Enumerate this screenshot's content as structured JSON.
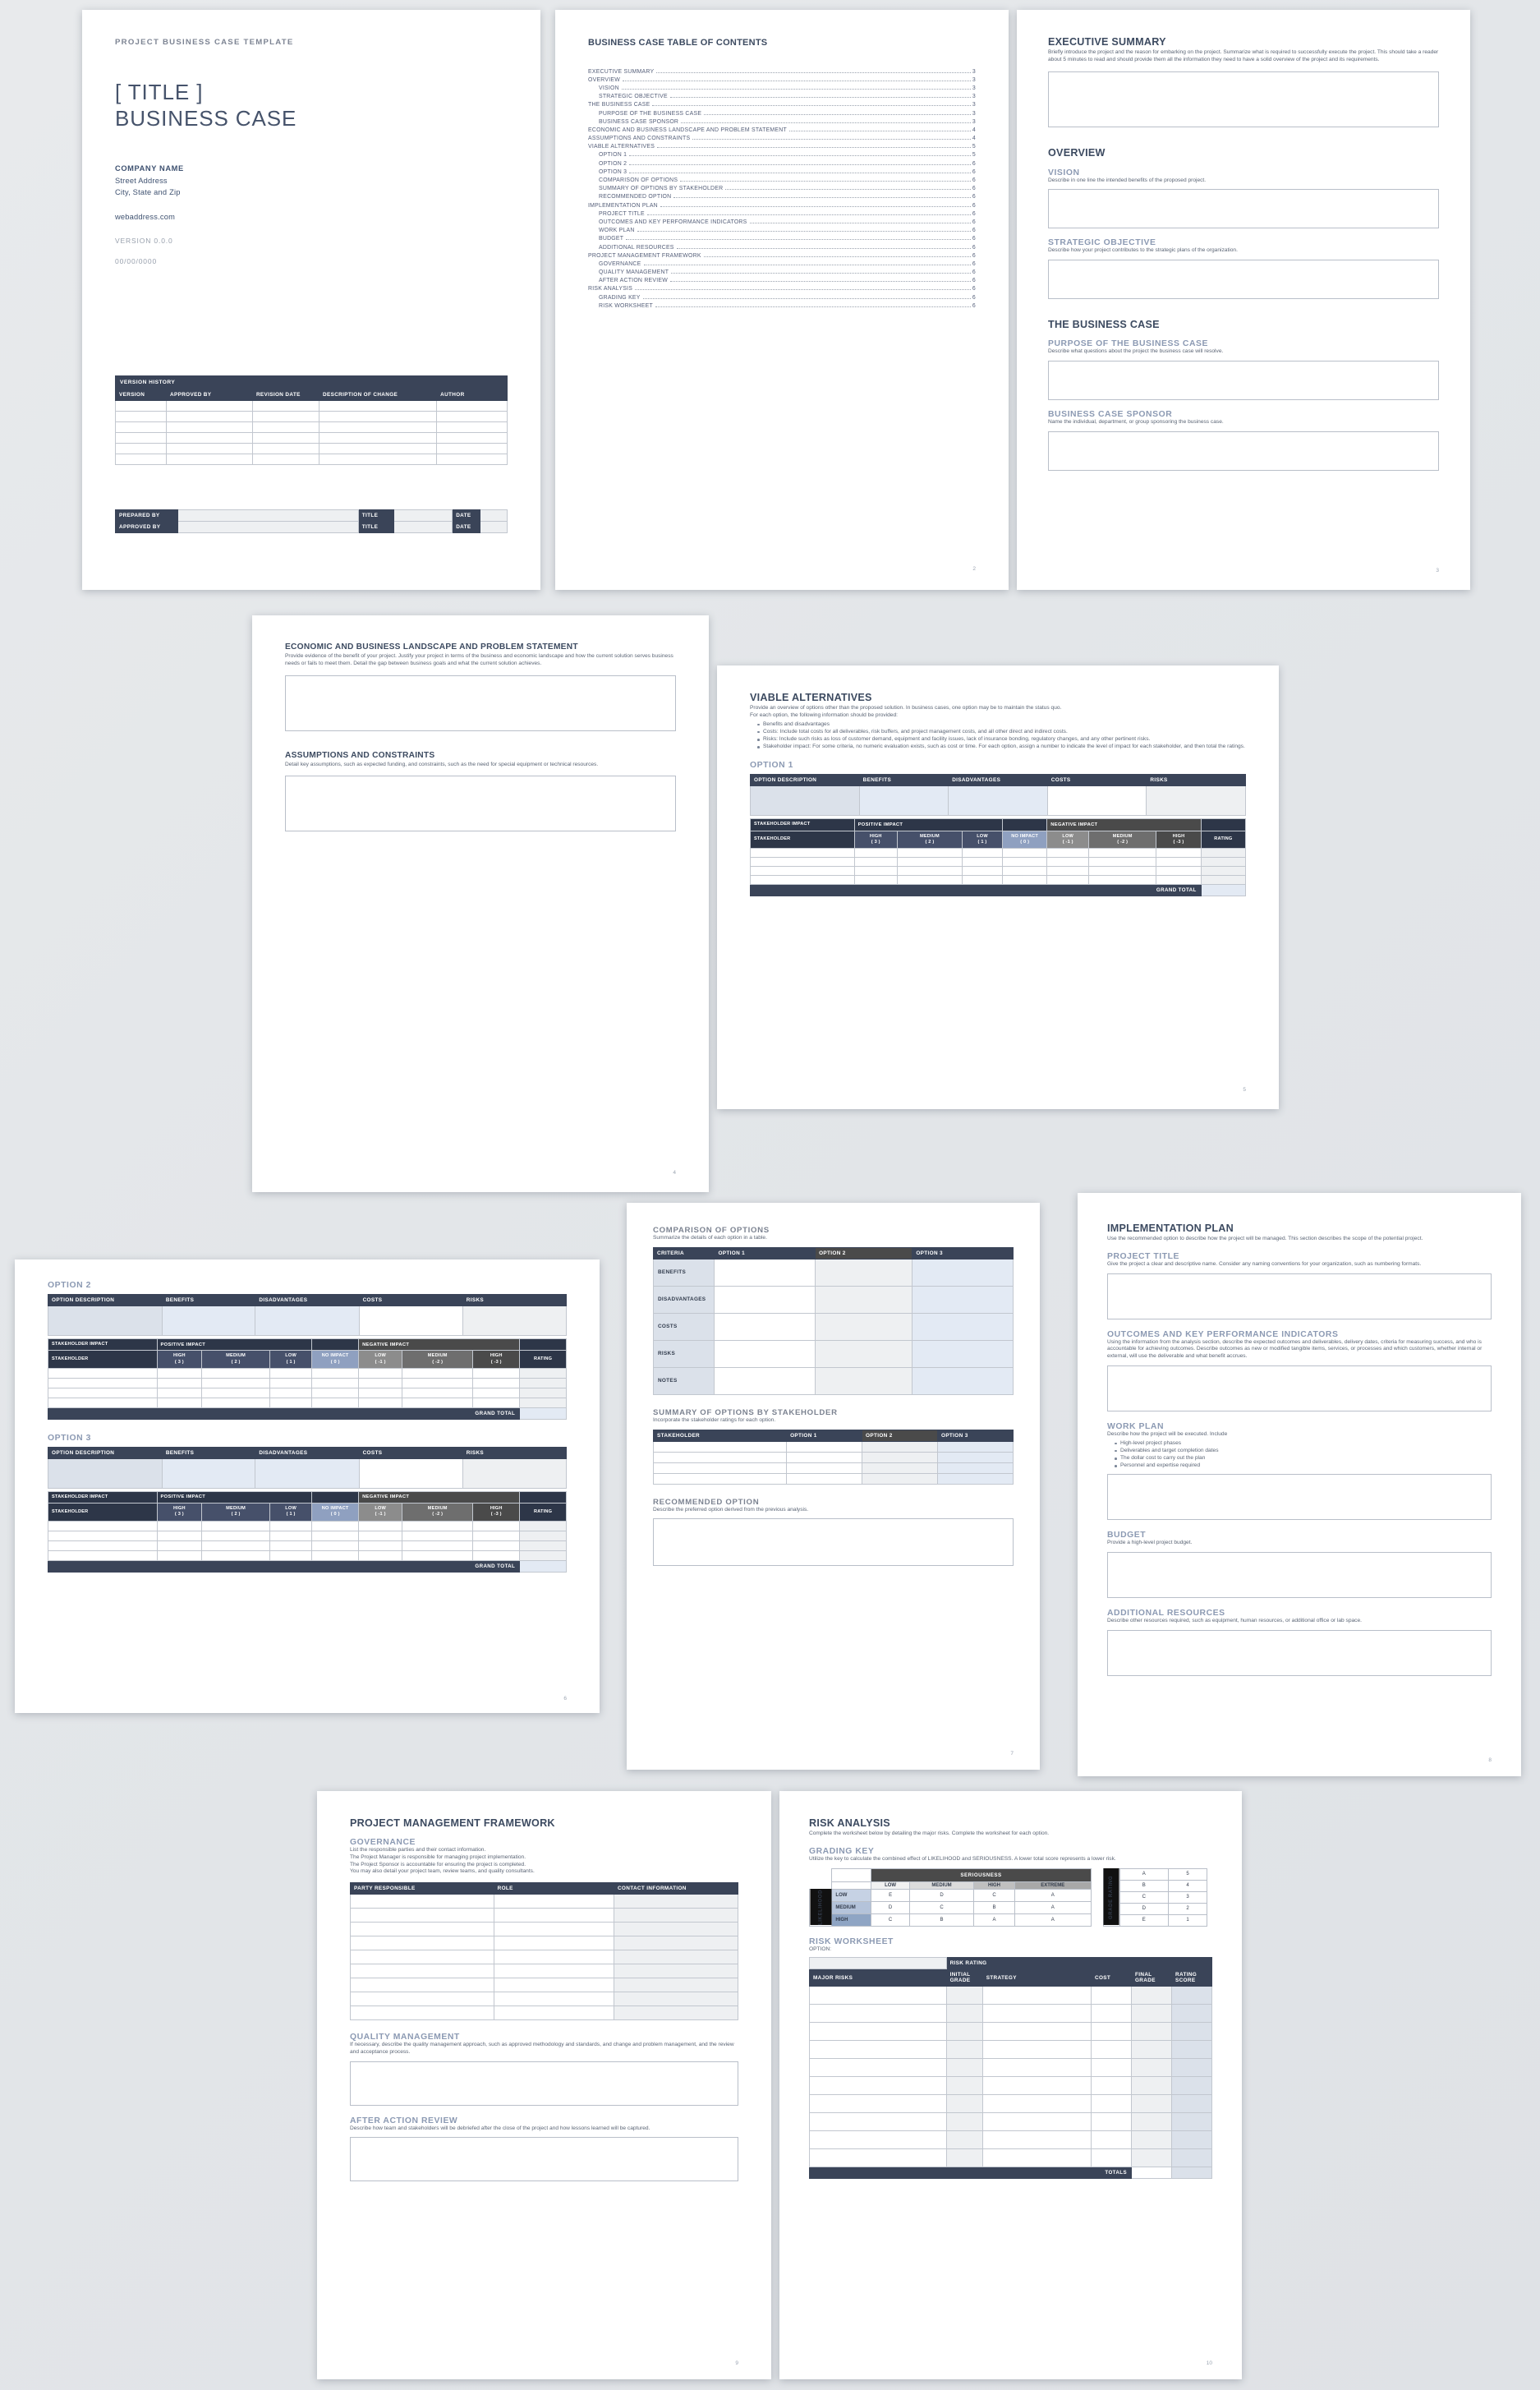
{
  "document": {
    "kicker": "PROJECT BUSINESS CASE TEMPLATE",
    "title_line1": "[ TITLE ]",
    "title_line2": "BUSINESS CASE"
  },
  "cover": {
    "company_name": "COMPANY NAME",
    "street": "Street Address",
    "city_state_zip": "City, State and Zip",
    "web": "webaddress.com",
    "version": "VERSION 0.0.0",
    "date": "00/00/0000",
    "version_history": {
      "band": "VERSION HISTORY",
      "headers": [
        "VERSION",
        "APPROVED BY",
        "REVISION DATE",
        "DESCRIPTION OF CHANGE",
        "AUTHOR"
      ],
      "row_count": 6
    },
    "signoff": {
      "prepared_by": "PREPARED BY",
      "approved_by": "APPROVED BY",
      "title": "TITLE",
      "date": "DATE"
    }
  },
  "toc": {
    "title": "BUSINESS CASE TABLE OF CONTENTS",
    "entries": [
      {
        "label": "EXECUTIVE SUMMARY",
        "page": "3",
        "sub": false
      },
      {
        "label": "OVERVIEW",
        "page": "3",
        "sub": false
      },
      {
        "label": "VISION",
        "page": "3",
        "sub": true
      },
      {
        "label": "STRATEGIC OBJECTIVE",
        "page": "3",
        "sub": true
      },
      {
        "label": "THE BUSINESS CASE",
        "page": "3",
        "sub": false
      },
      {
        "label": "PURPOSE OF THE BUSINESS CASE",
        "page": "3",
        "sub": true
      },
      {
        "label": "BUSINESS CASE SPONSOR",
        "page": "3",
        "sub": true
      },
      {
        "label": "ECONOMIC AND BUSINESS LANDSCAPE AND PROBLEM STATEMENT",
        "page": "4",
        "sub": false
      },
      {
        "label": "ASSUMPTIONS AND CONSTRAINTS",
        "page": "4",
        "sub": false
      },
      {
        "label": "VIABLE ALTERNATIVES",
        "page": "5",
        "sub": false
      },
      {
        "label": "OPTION 1",
        "page": "5",
        "sub": true
      },
      {
        "label": "OPTION 2",
        "page": "6",
        "sub": true
      },
      {
        "label": "OPTION 3",
        "page": "6",
        "sub": true
      },
      {
        "label": "COMPARISON OF OPTIONS",
        "page": "6",
        "sub": true
      },
      {
        "label": "SUMMARY OF OPTIONS BY STAKEHOLDER",
        "page": "6",
        "sub": true
      },
      {
        "label": "RECOMMENDED OPTION",
        "page": "6",
        "sub": true
      },
      {
        "label": "IMPLEMENTATION PLAN",
        "page": "6",
        "sub": false
      },
      {
        "label": "PROJECT TITLE",
        "page": "6",
        "sub": true
      },
      {
        "label": "OUTCOMES AND KEY PERFORMANCE INDICATORS",
        "page": "6",
        "sub": true
      },
      {
        "label": "WORK PLAN",
        "page": "6",
        "sub": true
      },
      {
        "label": "BUDGET",
        "page": "6",
        "sub": true
      },
      {
        "label": "ADDITIONAL RESOURCES",
        "page": "6",
        "sub": true
      },
      {
        "label": "PROJECT MANAGEMENT FRAMEWORK",
        "page": "6",
        "sub": false
      },
      {
        "label": "GOVERNANCE",
        "page": "6",
        "sub": true
      },
      {
        "label": "QUALITY MANAGEMENT",
        "page": "6",
        "sub": true
      },
      {
        "label": "AFTER ACTION REVIEW",
        "page": "6",
        "sub": true
      },
      {
        "label": "RISK ANALYSIS",
        "page": "6",
        "sub": false
      },
      {
        "label": "GRADING KEY",
        "page": "6",
        "sub": true
      },
      {
        "label": "RISK WORKSHEET",
        "page": "6",
        "sub": true
      }
    ],
    "page_number": "2"
  },
  "exec": {
    "exec_summary_title": "EXECUTIVE SUMMARY",
    "exec_summary_desc": "Briefly introduce the project and the reason for embarking on the project. Summarize what is required to successfully execute the project. This should take a reader about 5 minutes to read and should provide them all the information they need to have a solid overview of the project and its requirements.",
    "overview_title": "OVERVIEW",
    "vision_title": "VISION",
    "vision_desc": "Describe in one line the intended benefits of the proposed project.",
    "strategic_title": "STRATEGIC OBJECTIVE",
    "strategic_desc": "Describe how your project contributes to the strategic plans of the organization.",
    "business_case_title": "THE BUSINESS CASE",
    "purpose_title": "PURPOSE OF THE BUSINESS CASE",
    "purpose_desc": "Describe what questions about the project the business case will resolve.",
    "sponsor_title": "BUSINESS CASE SPONSOR",
    "sponsor_desc": "Name the individual, department, or group sponsoring the business case.",
    "page_number": "3"
  },
  "landscape": {
    "title": "ECONOMIC AND BUSINESS LANDSCAPE AND PROBLEM STATEMENT",
    "desc": "Provide evidence of the benefit of your project. Justify your project in terms of the business and economic landscape and how the current solution serves business needs or fails to meet them. Detail the gap between business goals and what the current solution achieves.",
    "assumptions_title": "ASSUMPTIONS AND CONSTRAINTS",
    "assumptions_desc": "Detail key assumptions, such as expected funding, and constraints, such as the need for special equipment or technical resources.",
    "page_number": "4"
  },
  "viable": {
    "title": "VIABLE ALTERNATIVES",
    "desc_line1": "Provide an overview of options other than the proposed solution. In business cases, one option may be to maintain the status quo.",
    "desc_line2": "For each option, the following information should be provided:",
    "bullets": [
      "Benefits and disadvantages",
      "Costs: Include total costs for all deliverables, risk buffers, and project management costs, and all other direct and indirect costs.",
      "Risks: Include such risks as loss of customer demand, equipment and facility issues, lack of insurance bonding, regulatory changes, and any other pertinent risks.",
      "Stakeholder impact: For some criteria, no numeric evaluation exists, such as cost or time. For each option, assign a number to indicate the level of impact for each stakeholder, and then total the ratings."
    ],
    "option1_label": "OPTION 1",
    "option2_label": "OPTION 2",
    "option3_label": "OPTION 3",
    "option_headers": [
      "OPTION DESCRIPTION",
      "BENEFITS",
      "DISADVANTAGES",
      "COSTS",
      "RISKS"
    ],
    "stakeholder_band": "STAKEHOLDER IMPACT",
    "positive_impact": "POSITIVE IMPACT",
    "negative_impact": "NEGATIVE IMPACT",
    "stakeholder_col": "STAKEHOLDER",
    "impact_levels": [
      {
        "label": "HIGH",
        "value": "( 3 )"
      },
      {
        "label": "MEDIUM",
        "value": "( 2 )"
      },
      {
        "label": "LOW",
        "value": "( 1 )"
      },
      {
        "label": "NO IMPACT",
        "value": "( 0 )"
      },
      {
        "label": "LOW",
        "value": "( -1 )"
      },
      {
        "label": "MEDIUM",
        "value": "( -2 )"
      },
      {
        "label": "HIGH",
        "value": "( -3 )"
      }
    ],
    "rating_col": "RATING",
    "grand_total": "GRAND TOTAL",
    "page5_number": "5",
    "page6_number": "6"
  },
  "comparison": {
    "title": "COMPARISON OF OPTIONS",
    "desc": "Summarize the details of each option in a table.",
    "headers": [
      "CRITERIA",
      "OPTION 1",
      "OPTION 2",
      "OPTION 3"
    ],
    "rows": [
      "BENEFITS",
      "DISADVANTAGES",
      "COSTS",
      "RISKS",
      "NOTES"
    ],
    "summary_title": "SUMMARY OF OPTIONS BY STAKEHOLDER",
    "summary_desc": "Incorporate the stakeholder ratings for each option.",
    "summary_headers": [
      "STAKEHOLDER",
      "OPTION 1",
      "OPTION 2",
      "OPTION 3"
    ],
    "summary_rows": 4,
    "recommended_title": "RECOMMENDED OPTION",
    "recommended_desc": "Describe the preferred option derived from the previous analysis.",
    "page_number": "7"
  },
  "implementation": {
    "title": "IMPLEMENTATION PLAN",
    "desc": "Use the recommended option to describe how the project will be managed. This section describes the scope of the potential project.",
    "project_title_title": "PROJECT TITLE",
    "project_title_desc": "Give the project a clear and descriptive name. Consider any naming conventions for your organization, such as numbering formats.",
    "outcomes_title": "OUTCOMES AND KEY PERFORMANCE INDICATORS",
    "outcomes_desc": "Using the information from the analysis section, describe the expected outcomes and deliverables, delivery dates, criteria for measuring success, and who is accountable for achieving outcomes. Describe outcomes as new or modified tangible items, services, or processes and which customers, whether internal or external, will use the deliverable and what benefit accrues.",
    "workplan_title": "WORK PLAN",
    "workplan_desc": "Describe how the project will be executed. Include",
    "workplan_bullets": [
      "High-level project phases",
      "Deliverables and target completion dates",
      "The dollar cost to carry out the plan",
      "Personnel and expertise required"
    ],
    "budget_title": "BUDGET",
    "budget_desc": "Provide a high-level project budget.",
    "resources_title": "ADDITIONAL RESOURCES",
    "resources_desc": "Describe other resources required, such as equipment, human resources, or additional office or lab space.",
    "page_number": "8"
  },
  "framework": {
    "title": "PROJECT MANAGEMENT FRAMEWORK",
    "governance_title": "GOVERNANCE",
    "governance_lines": [
      "List the responsible parties and their contact information.",
      "The Project Manager is responsible for managing project implementation.",
      "The Project Sponsor is accountable for ensuring the project is completed.",
      "You may also detail your project team, review teams, and quality consultants."
    ],
    "governance_headers": [
      "PARTY RESPONSIBLE",
      "ROLE",
      "CONTACT INFORMATION"
    ],
    "governance_rows": 9,
    "quality_title": "QUALITY MANAGEMENT",
    "quality_desc": "If necessary, describe the quality management approach, such as approved methodology and standards, and change and problem management, and the review and acceptance process.",
    "aar_title": "AFTER ACTION REVIEW",
    "aar_desc": "Describe how team and stakeholders will be debriefed after the close of the project and how lessons learned will be captured.",
    "page_number": "9"
  },
  "risk": {
    "title": "RISK ANALYSIS",
    "desc": "Complete the worksheet below by detailing the major risks.  Complete the worksheet for each option.",
    "grading_title": "GRADING KEY",
    "grading_desc": "Utilize the key to calculate the combined effect of LIKELIHOOD and SERIOUSNESS. A lower total score represents a lower risk.",
    "seriousness_label": "SERIOUSNESS",
    "likelihood_label": "LIKELIHOOD",
    "seriousness_levels": [
      "LOW",
      "MEDIUM",
      "HIGH",
      "EXTREME"
    ],
    "likelihood_levels": [
      "LOW",
      "MEDIUM",
      "HIGH"
    ],
    "matrix": [
      [
        "E",
        "D",
        "C",
        "A"
      ],
      [
        "D",
        "C",
        "B",
        "A"
      ],
      [
        "C",
        "B",
        "A",
        "A"
      ]
    ],
    "grade_rating_label": "GRADE RATING",
    "grade_ratings": [
      {
        "grade": "A",
        "score": "5"
      },
      {
        "grade": "B",
        "score": "4"
      },
      {
        "grade": "C",
        "score": "3"
      },
      {
        "grade": "D",
        "score": "2"
      },
      {
        "grade": "E",
        "score": "1"
      }
    ],
    "worksheet_title": "RISK WORKSHEET",
    "worksheet_option": "OPTION:",
    "risk_rating_band": "RISK RATING",
    "worksheet_headers": [
      "MAJOR RISKS",
      "INITIAL GRADE",
      "STRATEGY",
      "COST",
      "FINAL GRADE",
      "RATING SCORE"
    ],
    "worksheet_rows": 10,
    "totals_label": "TOTALS",
    "page_number": "10"
  },
  "colors": {
    "navy": "#3a4458",
    "dark_navy": "#2d3648",
    "gray_dark": "#4a4a4a",
    "accent_blue": "#8c9ab3",
    "light_blue_cell": "#e3eaf4",
    "light_gray_cell": "#eef0f2"
  }
}
